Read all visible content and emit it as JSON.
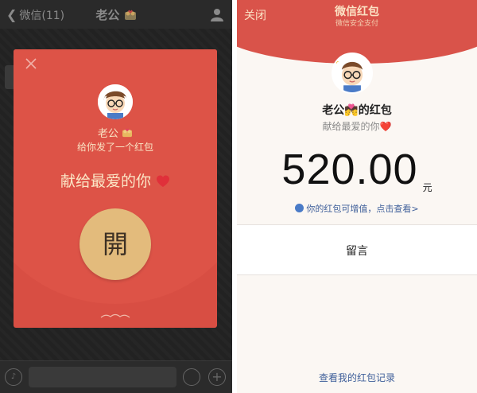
{
  "left": {
    "nav": {
      "back_label": "微信(11)",
      "title": "老公"
    },
    "envelope": {
      "sender_name": "老公",
      "subtitle": "给你发了一个红包",
      "greeting": "献给最爱的你",
      "open_button_label": "開"
    }
  },
  "right": {
    "close_label": "关闭",
    "title": "微信红包",
    "subtitle": "微信安全支付",
    "sender_title": "老公💏的红包",
    "greeting": "献给最爱的你❤️",
    "amount": "520.00",
    "currency": "元",
    "promo_link": "你的红包可增值，点击查看>",
    "message_button": "留言",
    "history_link": "查看我的红包记录"
  },
  "colors": {
    "envelope_red": "#d84e43",
    "header_red": "#d9534a",
    "open_button_gold": "#e3bb7c",
    "link_blue": "#3f5f9a"
  }
}
